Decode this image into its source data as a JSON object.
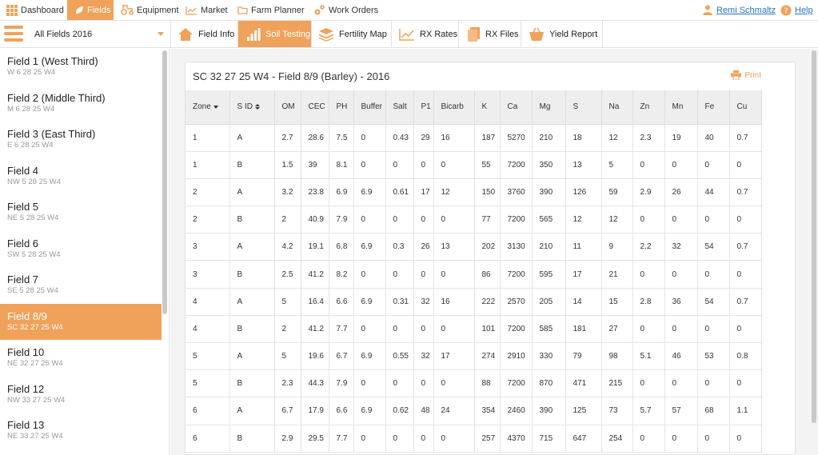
{
  "nav": {
    "items": [
      {
        "label": "Dashboard",
        "icon": "grid-icon"
      },
      {
        "label": "Fields",
        "icon": "leaf-icon",
        "active": true
      },
      {
        "label": "Equipment",
        "icon": "tractor-icon"
      },
      {
        "label": "Market",
        "icon": "chart-line-icon"
      },
      {
        "label": "Farm Planner",
        "icon": "folder-icon"
      },
      {
        "label": "Work Orders",
        "icon": "gears-icon"
      }
    ],
    "user": "Remi Schmaltz",
    "help": "Help"
  },
  "field_select": "All Fields 2016",
  "tabs": [
    {
      "label": "Field Info",
      "icon": "house-icon"
    },
    {
      "label": "Soil Testing",
      "icon": "bar-chart-icon",
      "active": true
    },
    {
      "label": "Fertility Map",
      "icon": "layers-icon"
    },
    {
      "label": "RX Rates",
      "icon": "line-chart-icon"
    },
    {
      "label": "RX Files",
      "icon": "files-icon"
    },
    {
      "label": "Yield Report",
      "icon": "basket-icon"
    }
  ],
  "fields": [
    {
      "name": "Field 1 (West Third)",
      "loc": "W 6 28 25 W4"
    },
    {
      "name": "Field 2 (Middle Third)",
      "loc": "M 6 28 25 W4"
    },
    {
      "name": "Field 3 (East Third)",
      "loc": "E 6 28 25 W4"
    },
    {
      "name": "Field 4",
      "loc": "NW 5 28 25 W4"
    },
    {
      "name": "Field 5",
      "loc": "NE 5 28 25 W4"
    },
    {
      "name": "Field 6",
      "loc": "SW 5 28 25 W4"
    },
    {
      "name": "Field 7",
      "loc": "SE 5 28 25 W4"
    },
    {
      "name": "Field 8/9",
      "loc": "SC 32 27 25 W4",
      "active": true
    },
    {
      "name": "Field 10",
      "loc": "NE 32 27 25 W4"
    },
    {
      "name": "Field 12",
      "loc": "NW 33 27 25 W4"
    },
    {
      "name": "Field 13",
      "loc": "NE 33 27 25 W4"
    }
  ],
  "panel": {
    "title": "SC 32 27 25 W4 - Field 8/9 (Barley) - 2016",
    "print": "Print"
  },
  "table": {
    "columns": [
      "Zone",
      "S ID",
      "OM",
      "CEC",
      "PH",
      "Buffer",
      "Salt",
      "P1",
      "Bicarb",
      "K",
      "Ca",
      "Mg",
      "S",
      "Na",
      "Zn",
      "Mn",
      "Fe",
      "Cu"
    ],
    "rows": [
      [
        "1",
        "A",
        "2.7",
        "28.6",
        "7.5",
        "0",
        "0.43",
        "29",
        "16",
        "187",
        "5270",
        "210",
        "18",
        "12",
        "2.3",
        "19",
        "40",
        "0.7"
      ],
      [
        "1",
        "B",
        "1.5",
        "39",
        "8.1",
        "0",
        "0",
        "0",
        "0",
        "55",
        "7200",
        "350",
        "13",
        "5",
        "0",
        "0",
        "0",
        "0"
      ],
      [
        "2",
        "A",
        "3.2",
        "23.8",
        "6.9",
        "6.9",
        "0.61",
        "17",
        "12",
        "150",
        "3760",
        "390",
        "126",
        "59",
        "2.9",
        "26",
        "44",
        "0.7"
      ],
      [
        "2",
        "B",
        "2",
        "40.9",
        "7.9",
        "0",
        "0",
        "0",
        "0",
        "77",
        "7200",
        "565",
        "12",
        "12",
        "0",
        "0",
        "0",
        "0"
      ],
      [
        "3",
        "A",
        "4.2",
        "19.1",
        "6.8",
        "6.9",
        "0.3",
        "26",
        "13",
        "202",
        "3130",
        "210",
        "11",
        "9",
        "2.2",
        "32",
        "54",
        "0.7"
      ],
      [
        "3",
        "B",
        "2.5",
        "41.2",
        "8.2",
        "0",
        "0",
        "0",
        "0",
        "86",
        "7200",
        "595",
        "17",
        "21",
        "0",
        "0",
        "0",
        "0"
      ],
      [
        "4",
        "A",
        "5",
        "16.4",
        "6.6",
        "6.9",
        "0.31",
        "32",
        "16",
        "222",
        "2570",
        "205",
        "14",
        "15",
        "2.8",
        "36",
        "54",
        "0.7"
      ],
      [
        "4",
        "B",
        "2",
        "41.2",
        "7.7",
        "0",
        "0",
        "0",
        "0",
        "101",
        "7200",
        "585",
        "181",
        "27",
        "0",
        "0",
        "0",
        "0"
      ],
      [
        "5",
        "A",
        "5",
        "19.6",
        "6.7",
        "6.9",
        "0.55",
        "32",
        "17",
        "274",
        "2910",
        "330",
        "79",
        "98",
        "5.1",
        "46",
        "53",
        "0.8"
      ],
      [
        "5",
        "B",
        "2.3",
        "44.3",
        "7.9",
        "0",
        "0",
        "0",
        "0",
        "88",
        "7200",
        "870",
        "471",
        "215",
        "0",
        "0",
        "0",
        "0"
      ],
      [
        "6",
        "A",
        "6.7",
        "17.9",
        "6.6",
        "6.9",
        "0.62",
        "48",
        "24",
        "354",
        "2460",
        "390",
        "125",
        "73",
        "5.7",
        "57",
        "68",
        "1.1"
      ],
      [
        "6",
        "B",
        "2.9",
        "29.5",
        "7.7",
        "0",
        "0",
        "0",
        "0",
        "257",
        "4370",
        "715",
        "647",
        "254",
        "0",
        "0",
        "0",
        "0"
      ]
    ]
  },
  "colors": {
    "accent": "#f0a25a",
    "link": "#2a73c2"
  }
}
